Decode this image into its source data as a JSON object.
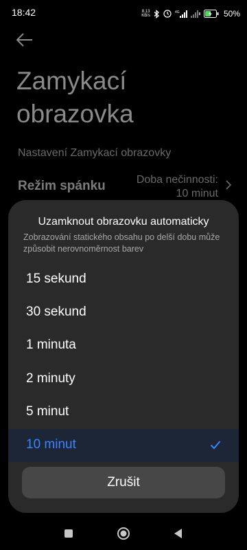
{
  "status_bar": {
    "time": "18:42",
    "net_speed_value": "8,13",
    "net_speed_unit": "KB/s",
    "signal_label": "4G",
    "battery": "50%",
    "icons": [
      "bluetooth-icon",
      "alarm-icon",
      "signal-icon",
      "signal-icon",
      "battery-icon"
    ]
  },
  "page": {
    "title": "Zamykací obrazovka",
    "section_header": "Nastavení Zamykací obrazovky",
    "sleep_row": {
      "title": "Režim spánku",
      "value_line1": "Doba nečinnosti:",
      "value_line2": "10 minut"
    }
  },
  "dialog": {
    "title": "Uzamknout obrazovku automaticky",
    "description": "Zobrazování statického obsahu po delší dobu může způsobit nerovnoměrnost barev",
    "options": [
      {
        "label": "15 sekund",
        "selected": false
      },
      {
        "label": "30 sekund",
        "selected": false
      },
      {
        "label": "1 minuta",
        "selected": false
      },
      {
        "label": "2 minuty",
        "selected": false
      },
      {
        "label": "5 minut",
        "selected": false
      },
      {
        "label": "10 minut",
        "selected": true
      }
    ],
    "cancel_label": "Zrušit"
  },
  "colors": {
    "accent": "#3a85ff",
    "dialog_bg": "#2a2a2a",
    "selected_bg": "#1c2636",
    "button_bg": "#474747"
  },
  "nav_bar": {
    "icons": [
      "recents-square-icon",
      "home-circle-icon",
      "back-triangle-icon"
    ]
  }
}
